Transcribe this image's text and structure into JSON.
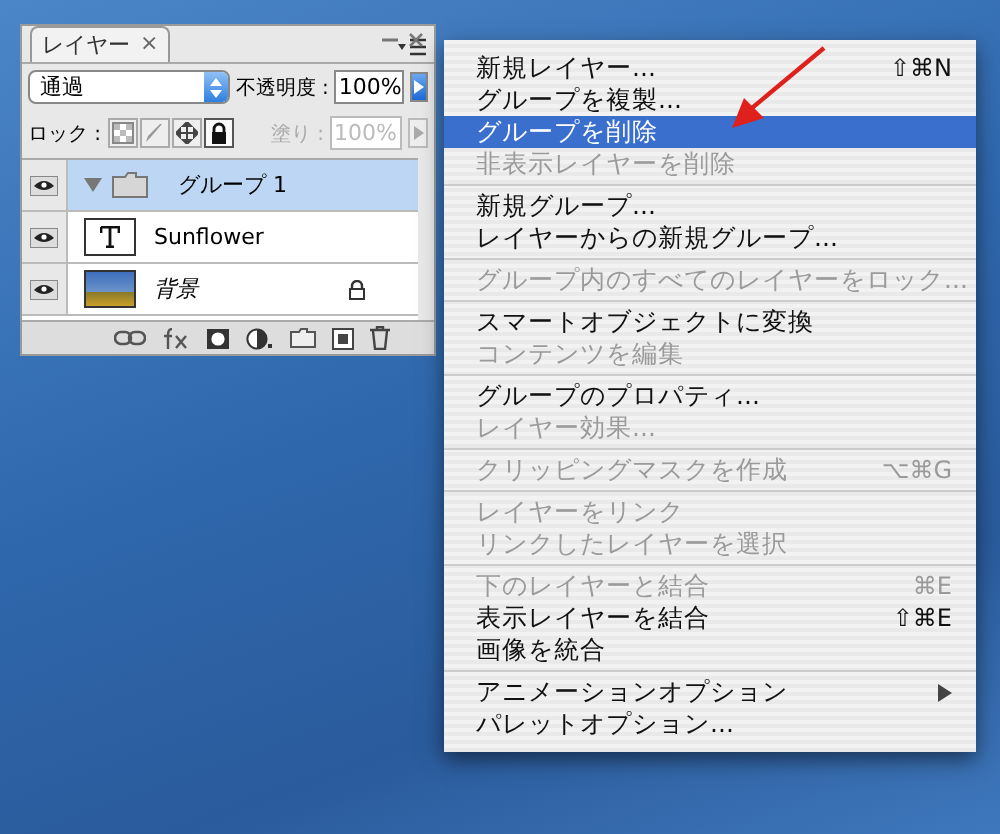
{
  "panel": {
    "tab": {
      "label": "レイヤー",
      "close": "×"
    },
    "blend_mode": "通過",
    "opacity_label": "不透明度 :",
    "opacity": "100%",
    "lock_label": "ロック :",
    "lock_buttons": [
      {
        "kind": "transparency",
        "selected": false
      },
      {
        "kind": "paint",
        "selected": false
      },
      {
        "kind": "move",
        "selected": false
      },
      {
        "kind": "all",
        "selected": true
      }
    ],
    "fill_label": "塗り :",
    "fill": "100%",
    "fill_disabled": true,
    "layers": [
      {
        "kind": "group",
        "name": "グループ 1",
        "visible": true,
        "selected": true,
        "expanded": true,
        "locked": false,
        "italic": false
      },
      {
        "kind": "text",
        "name": "Sunflower",
        "visible": true,
        "selected": false,
        "locked": false,
        "italic": false
      },
      {
        "kind": "image",
        "name": "背景",
        "visible": true,
        "selected": false,
        "locked": true,
        "italic": true
      }
    ]
  },
  "menu": {
    "groups": [
      [
        {
          "kind": "command",
          "label": "新規レイヤー...",
          "shortcut": "⇧⌘N",
          "disabled": false,
          "selected": false
        },
        {
          "kind": "command",
          "label": "グループを複製...",
          "disabled": false,
          "selected": false
        },
        {
          "kind": "command",
          "label": "グループを削除",
          "disabled": false,
          "selected": true
        },
        {
          "kind": "command",
          "label": "非表示レイヤーを削除",
          "disabled": true,
          "selected": false
        }
      ],
      [
        {
          "kind": "command",
          "label": "新規グループ...",
          "disabled": false,
          "selected": false
        },
        {
          "kind": "command",
          "label": "レイヤーからの新規グループ...",
          "disabled": false,
          "selected": false
        }
      ],
      [
        {
          "kind": "command",
          "label": "グループ内のすべてのレイヤーをロック...",
          "disabled": true,
          "selected": false
        }
      ],
      [
        {
          "kind": "command",
          "label": "スマートオブジェクトに変換",
          "disabled": false,
          "selected": false
        },
        {
          "kind": "command",
          "label": "コンテンツを編集",
          "disabled": true,
          "selected": false
        }
      ],
      [
        {
          "kind": "command",
          "label": "グループのプロパティ...",
          "disabled": false,
          "selected": false
        },
        {
          "kind": "command",
          "label": "レイヤー効果...",
          "disabled": true,
          "selected": false
        }
      ],
      [
        {
          "kind": "command",
          "label": "クリッピングマスクを作成",
          "shortcut": "⌥⌘G",
          "disabled": true,
          "selected": false
        }
      ],
      [
        {
          "kind": "command",
          "label": "レイヤーをリンク",
          "disabled": true,
          "selected": false
        },
        {
          "kind": "command",
          "label": "リンクしたレイヤーを選択",
          "disabled": true,
          "selected": false
        }
      ],
      [
        {
          "kind": "command",
          "label": "下のレイヤーと結合",
          "shortcut": "⌘E",
          "disabled": true,
          "selected": false
        },
        {
          "kind": "command",
          "label": "表示レイヤーを結合",
          "shortcut": "⇧⌘E",
          "disabled": false,
          "selected": false
        },
        {
          "kind": "command",
          "label": "画像を統合",
          "disabled": false,
          "selected": false
        }
      ],
      [
        {
          "kind": "submenu",
          "label": "アニメーションオプション",
          "disabled": false,
          "selected": false
        },
        {
          "kind": "command",
          "label": "パレットオプション...",
          "disabled": false,
          "selected": false
        }
      ]
    ]
  }
}
